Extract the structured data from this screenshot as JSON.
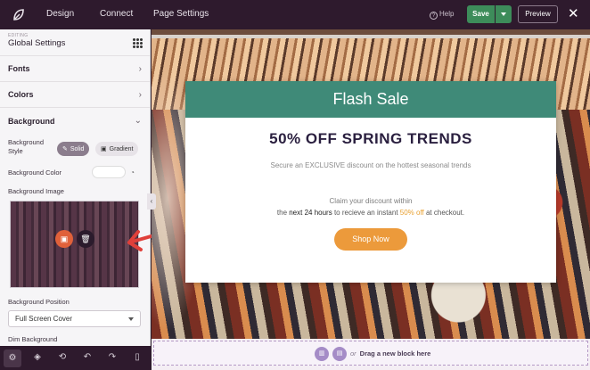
{
  "topbar": {
    "nav": [
      "Design",
      "Connect",
      "Page Settings"
    ],
    "help": "Help",
    "save": "Save",
    "preview": "Preview"
  },
  "sidebar": {
    "editing_label": "EDITING",
    "title": "Global Settings",
    "sections": [
      "Fonts",
      "Colors",
      "Background"
    ],
    "bg_style_label": "Background Style",
    "style_solid": "Solid",
    "style_gradient": "Gradient",
    "bg_color_label": "Background Color",
    "bg_image_label": "Background Image",
    "bg_position_label": "Background Position",
    "bg_position_value": "Full Screen Cover",
    "dim_label": "Dim Background"
  },
  "canvas": {
    "card_header": "Flash Sale",
    "headline": "50% OFF SPRING TRENDS",
    "subtitle": "Secure an EXCLUSIVE discount on the hottest seasonal trends",
    "claim_line1": "Claim your discount within",
    "claim_line2_a": "the ",
    "claim_line2_b": "next 24 hours",
    "claim_line2_c": " to recieve an instant ",
    "claim_line2_d": "50% off",
    "claim_line2_e": " at checkout.",
    "button": "Shop Now",
    "drop_or": "or",
    "drop_text": "Drag a new block here"
  },
  "colors": {
    "topbar": "#2e1a2d",
    "save": "#3d8c5a",
    "card_header": "#3f8a78",
    "cta": "#ec9a3b",
    "arrow": "#e0403a"
  }
}
